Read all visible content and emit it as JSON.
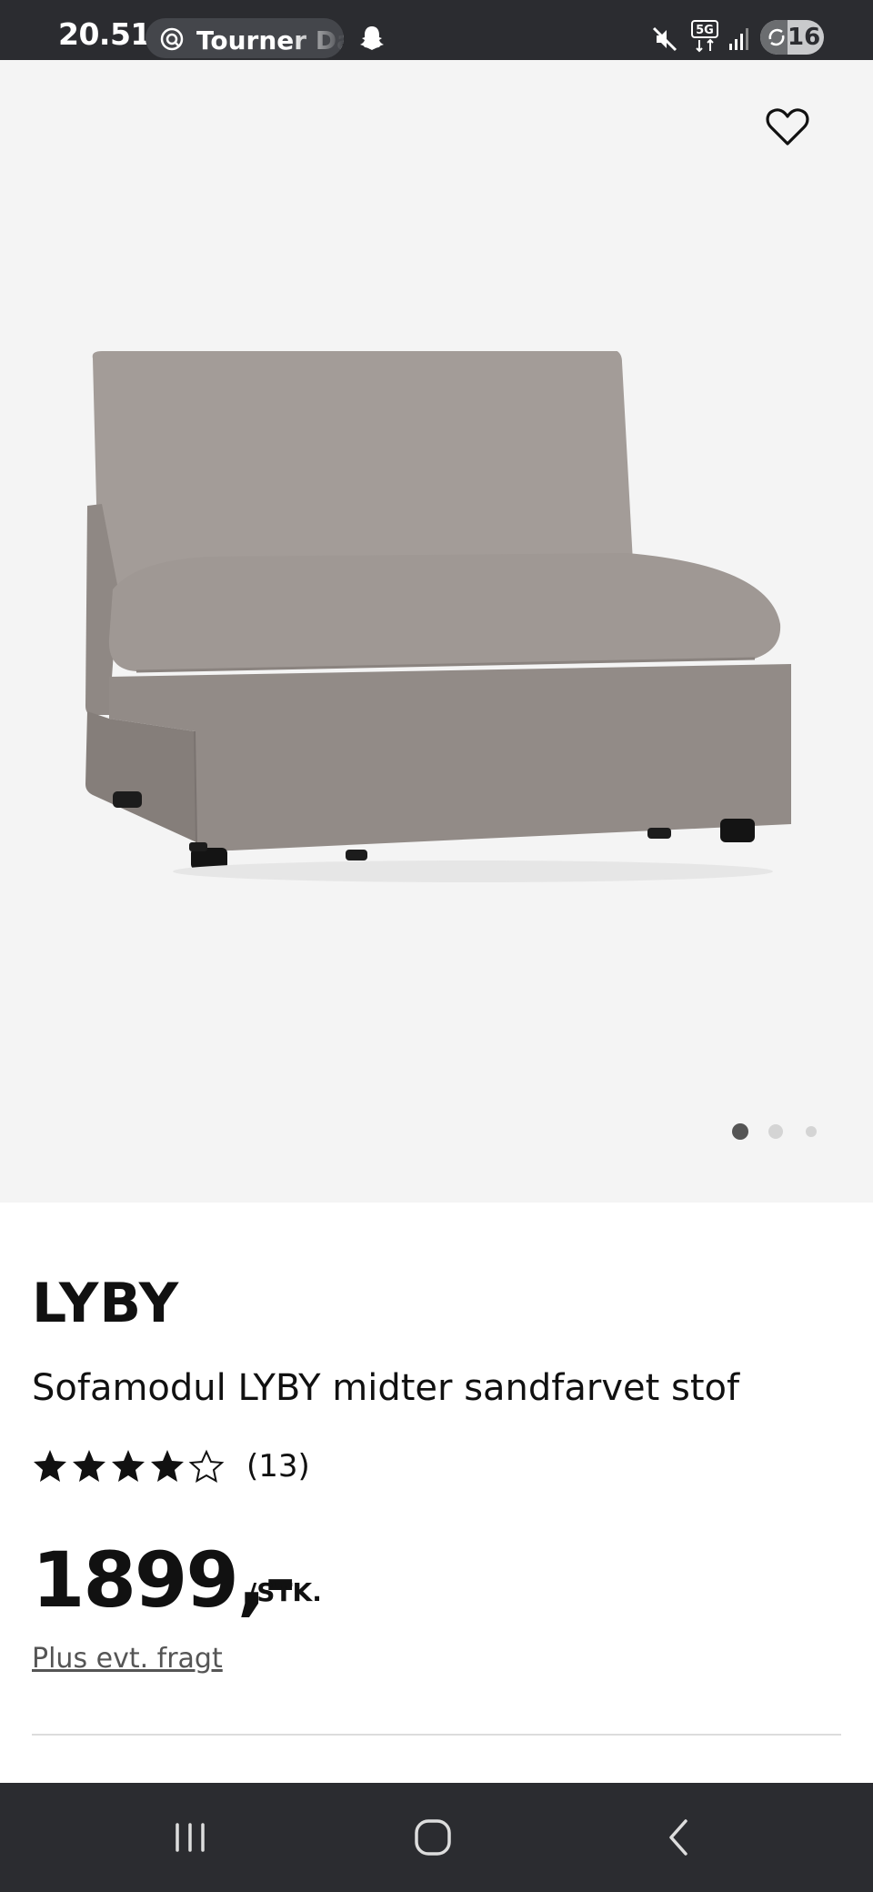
{
  "status_bar": {
    "time": "20.51",
    "notification_text": "Tourner Da",
    "battery_level": "16"
  },
  "product": {
    "brand": "LYBY",
    "title": "Sofamodul LYBY midter sandfarvet stof",
    "rating": {
      "stars_filled": 4,
      "stars_total": 5,
      "count_label": "(13)"
    },
    "price": "1899,-",
    "price_unit": "/STK.",
    "freight_link": "Plus evt. fragt"
  },
  "gallery": {
    "image_count": 3,
    "active_index": 0,
    "colors": {
      "active_dot": "#555555",
      "inactive_dot": "#d4d4d4",
      "background": "#f4f4f4"
    }
  },
  "icons": {
    "wishlist": "heart-icon",
    "nav_recents": "recents-icon",
    "nav_home": "home-icon",
    "nav_back": "back-icon"
  }
}
